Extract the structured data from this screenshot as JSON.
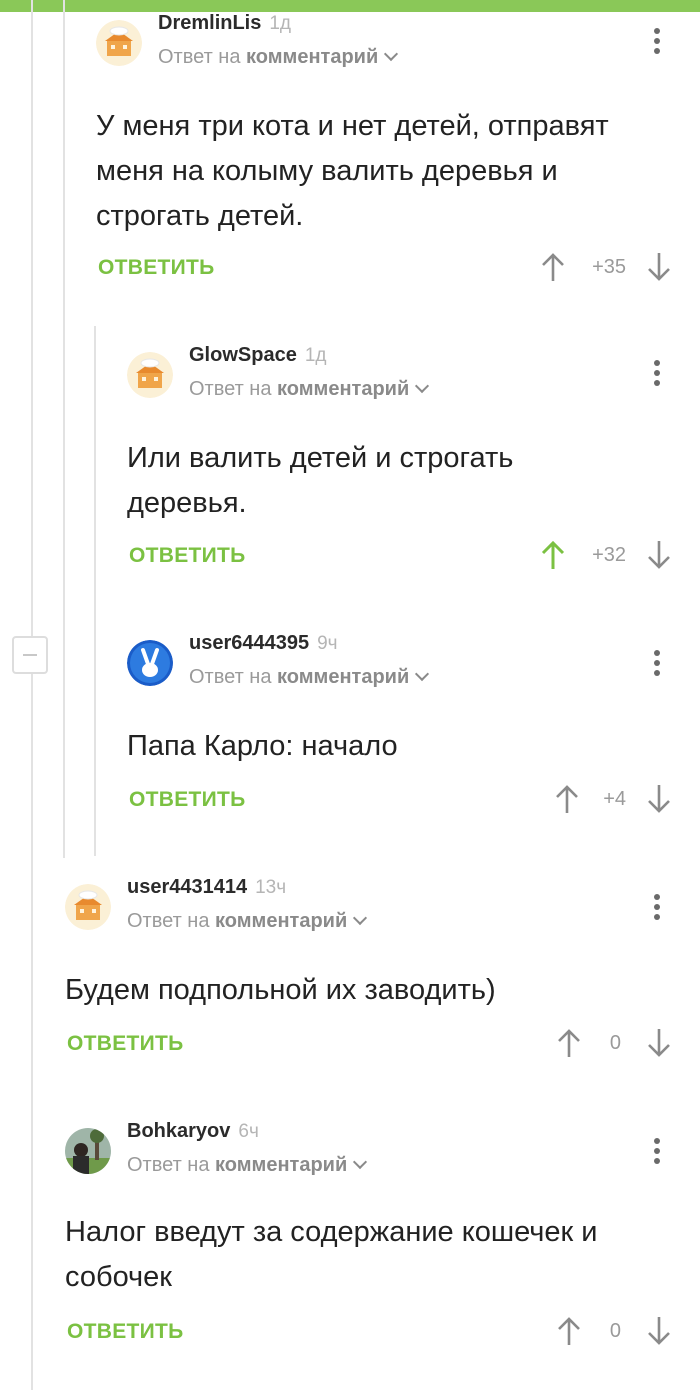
{
  "colors": {
    "accent": "#7bc142",
    "status_bar": "#8ac858",
    "muted": "#9a9a9a"
  },
  "labels": {
    "reply_prefix": "Ответ на",
    "reply_target": "комментарий",
    "reply_button": "ОТВЕТИТЬ"
  },
  "comments": [
    {
      "author": "DremlinLis",
      "age": "1д",
      "avatar": "default-avatar-icon",
      "text_lines": [
        "У меня три кота и нет детей, отправят",
        "меня на колыму валить деревья и",
        "строгать детей."
      ],
      "score": "+35",
      "upvoted": false
    },
    {
      "author": "GlowSpace",
      "age": "1д",
      "avatar": "default-avatar-icon",
      "text_lines": [
        "Или валить детей и строгать",
        "деревья."
      ],
      "score": "+32",
      "upvoted": true
    },
    {
      "author": "user6444395",
      "age": "9ч",
      "avatar": "victory-hand-avatar-icon",
      "text_lines": [
        "Папа Карло: начало"
      ],
      "score": "+4",
      "upvoted": false
    },
    {
      "author": "user4431414",
      "age": "13ч",
      "avatar": "default-avatar-icon",
      "text_lines": [
        "Будем подпольной их заводить)"
      ],
      "score": "0",
      "upvoted": false
    },
    {
      "author": "Bohkaryov",
      "age": "6ч",
      "avatar": "photo-avatar-icon",
      "text_lines": [
        "Налог введут за содержание кошечек и",
        "собочек"
      ],
      "score": "0",
      "upvoted": false
    }
  ]
}
